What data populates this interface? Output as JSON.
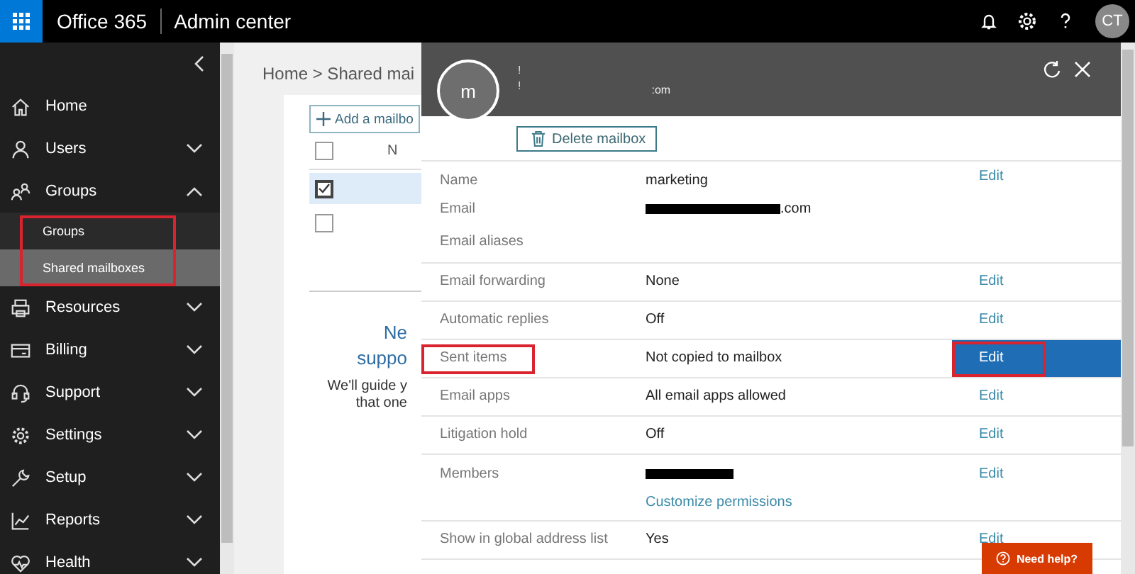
{
  "top_bar": {
    "brand": "Office 365",
    "app": "Admin center",
    "avatar": "CT"
  },
  "sidebar": {
    "items": [
      {
        "label": "Home"
      },
      {
        "label": "Users",
        "expanded": false
      },
      {
        "label": "Groups",
        "expanded": true,
        "children_highlighted": true,
        "children": [
          {
            "label": "Groups",
            "selected": false
          },
          {
            "label": "Shared mailboxes",
            "selected": true
          }
        ]
      },
      {
        "label": "Resources",
        "expanded": false
      },
      {
        "label": "Billing",
        "expanded": false
      },
      {
        "label": "Support",
        "expanded": false
      },
      {
        "label": "Settings",
        "expanded": false
      },
      {
        "label": "Setup",
        "expanded": false
      },
      {
        "label": "Reports",
        "expanded": false
      },
      {
        "label": "Health",
        "expanded": false
      }
    ]
  },
  "main": {
    "breadcrumb": "Home > Shared mai",
    "add_button": "Add a mailbo",
    "header_checked": false,
    "column_1": "N",
    "rows": [
      {
        "checked": true,
        "selected": true
      },
      {
        "checked": false,
        "selected": false
      }
    ],
    "promo_title": [
      "Ne",
      "suppo"
    ],
    "promo_text": [
      "We'll guide y",
      "that one"
    ]
  },
  "panel": {
    "avatar": "m",
    "header_lines": [
      "!",
      "!"
    ],
    "header_domain": ":om",
    "delete_button": "Delete mailbox",
    "sections": [
      {
        "fields": [
          {
            "label": "Name",
            "value": "marketing",
            "edit": "Edit",
            "selected": false
          },
          {
            "label": "Email",
            "redacted": true,
            "value": ".com"
          },
          {
            "label": "Email aliases"
          }
        ]
      },
      {
        "fields": [
          {
            "label": "Email forwarding",
            "value": "None",
            "edit": "Edit",
            "selected": false
          }
        ]
      },
      {
        "fields": [
          {
            "label": "Automatic replies",
            "value": "Off",
            "edit": "Edit",
            "selected": false
          }
        ]
      },
      {
        "fields": [
          {
            "label": "Sent items",
            "value": "Not copied to mailbox",
            "edit": "Edit",
            "selected": true,
            "highlighted": true
          }
        ]
      },
      {
        "fields": [
          {
            "label": "Email apps",
            "value": "All email apps allowed",
            "edit": "Edit",
            "selected": false
          }
        ]
      },
      {
        "fields": [
          {
            "label": "Litigation hold",
            "value": "Off",
            "edit": "Edit",
            "selected": false
          }
        ]
      },
      {
        "fields": [
          {
            "label": "Members",
            "redacted": true,
            "edit": "Edit",
            "selected": false,
            "link": "Customize permissions"
          }
        ]
      },
      {
        "fields": [
          {
            "label": "Show in global address list",
            "value": "Yes",
            "edit": "Edit",
            "selected": false
          }
        ]
      }
    ],
    "help_button": "Need help?"
  }
}
